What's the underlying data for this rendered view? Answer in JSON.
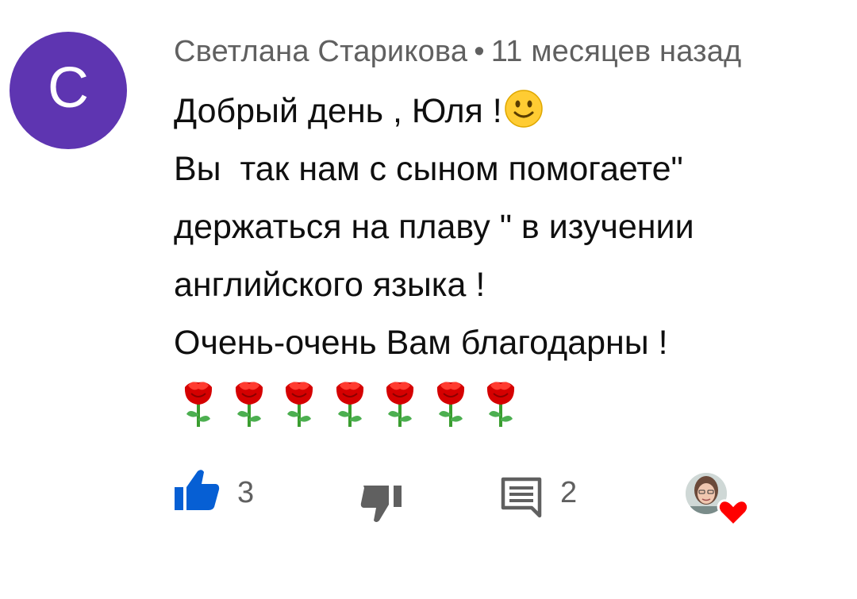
{
  "comment": {
    "avatar_letter": "С",
    "author": "Светлана Старикова",
    "separator": "•",
    "time": "11 месяцев назад",
    "lines": [
      "Добрый день , Юля !",
      "Вы  так нам с сыном помогаете\"",
      "держаться на плаву \" в изучении",
      "английского языка !",
      "Очень-очень Вам благодарны !"
    ],
    "emoji_after_greeting": "slightly-smiling-face",
    "rose_count": 7
  },
  "actions": {
    "like_icon": "thumbs-up-icon",
    "like_count": "3",
    "dislike_icon": "thumbs-down-icon",
    "reply_icon": "comment-icon",
    "reply_count": "2",
    "creator_heart": "creator-heart-avatar"
  },
  "colors": {
    "avatar_bg": "#5e35b1",
    "like_active": "#065fd4",
    "meta_text": "#606060",
    "body_text": "#0f0f0f",
    "heart": "#ff0000"
  }
}
